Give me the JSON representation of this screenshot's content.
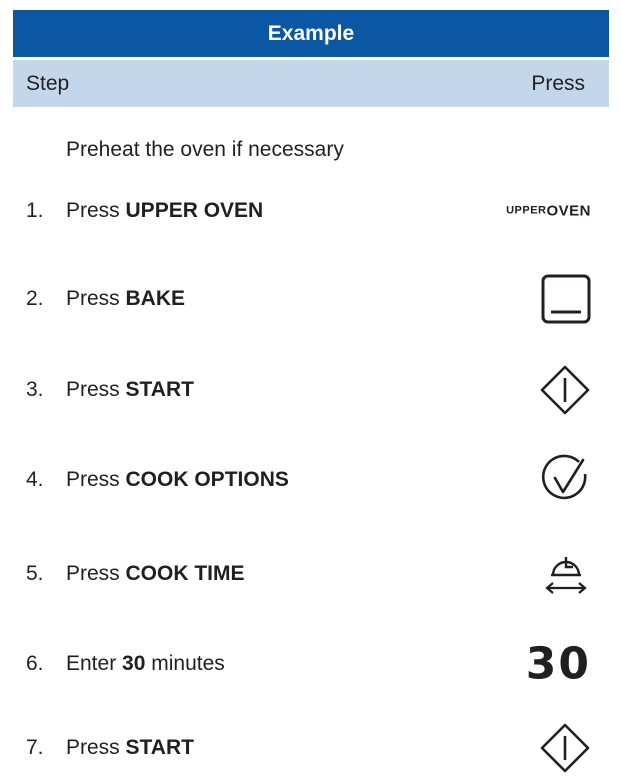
{
  "header": {
    "title": "Example"
  },
  "columns": {
    "step": "Step",
    "press": "Press"
  },
  "intro": "Preheat the oven if necessary",
  "colors": {
    "header_bg": "#0b57a4",
    "subheader_bg": "#c4d7ea",
    "text": "#231f20"
  },
  "steps": [
    {
      "num": "1.",
      "prefix": "Press ",
      "bold": "UPPER OVEN",
      "suffix": "",
      "icon": "upper-oven-label",
      "icon_text": [
        "UPPER",
        "OVEN"
      ]
    },
    {
      "num": "2.",
      "prefix": "Press ",
      "bold": "BAKE",
      "suffix": "",
      "icon": "bake-icon"
    },
    {
      "num": "3.",
      "prefix": "Press ",
      "bold": "START",
      "suffix": "",
      "icon": "start-icon"
    },
    {
      "num": "4.",
      "prefix": "Press ",
      "bold": "COOK OPTIONS",
      "suffix": "",
      "icon": "check-circle-icon"
    },
    {
      "num": "5.",
      "prefix": "Press ",
      "bold": "COOK TIME",
      "suffix": "",
      "icon": "cook-time-icon"
    },
    {
      "num": "6.",
      "prefix": "Enter ",
      "bold": "30",
      "suffix": " minutes",
      "icon": "number-display",
      "icon_text": [
        "30"
      ]
    },
    {
      "num": "7.",
      "prefix": "Press ",
      "bold": "START",
      "suffix": "",
      "icon": "start-icon"
    }
  ]
}
